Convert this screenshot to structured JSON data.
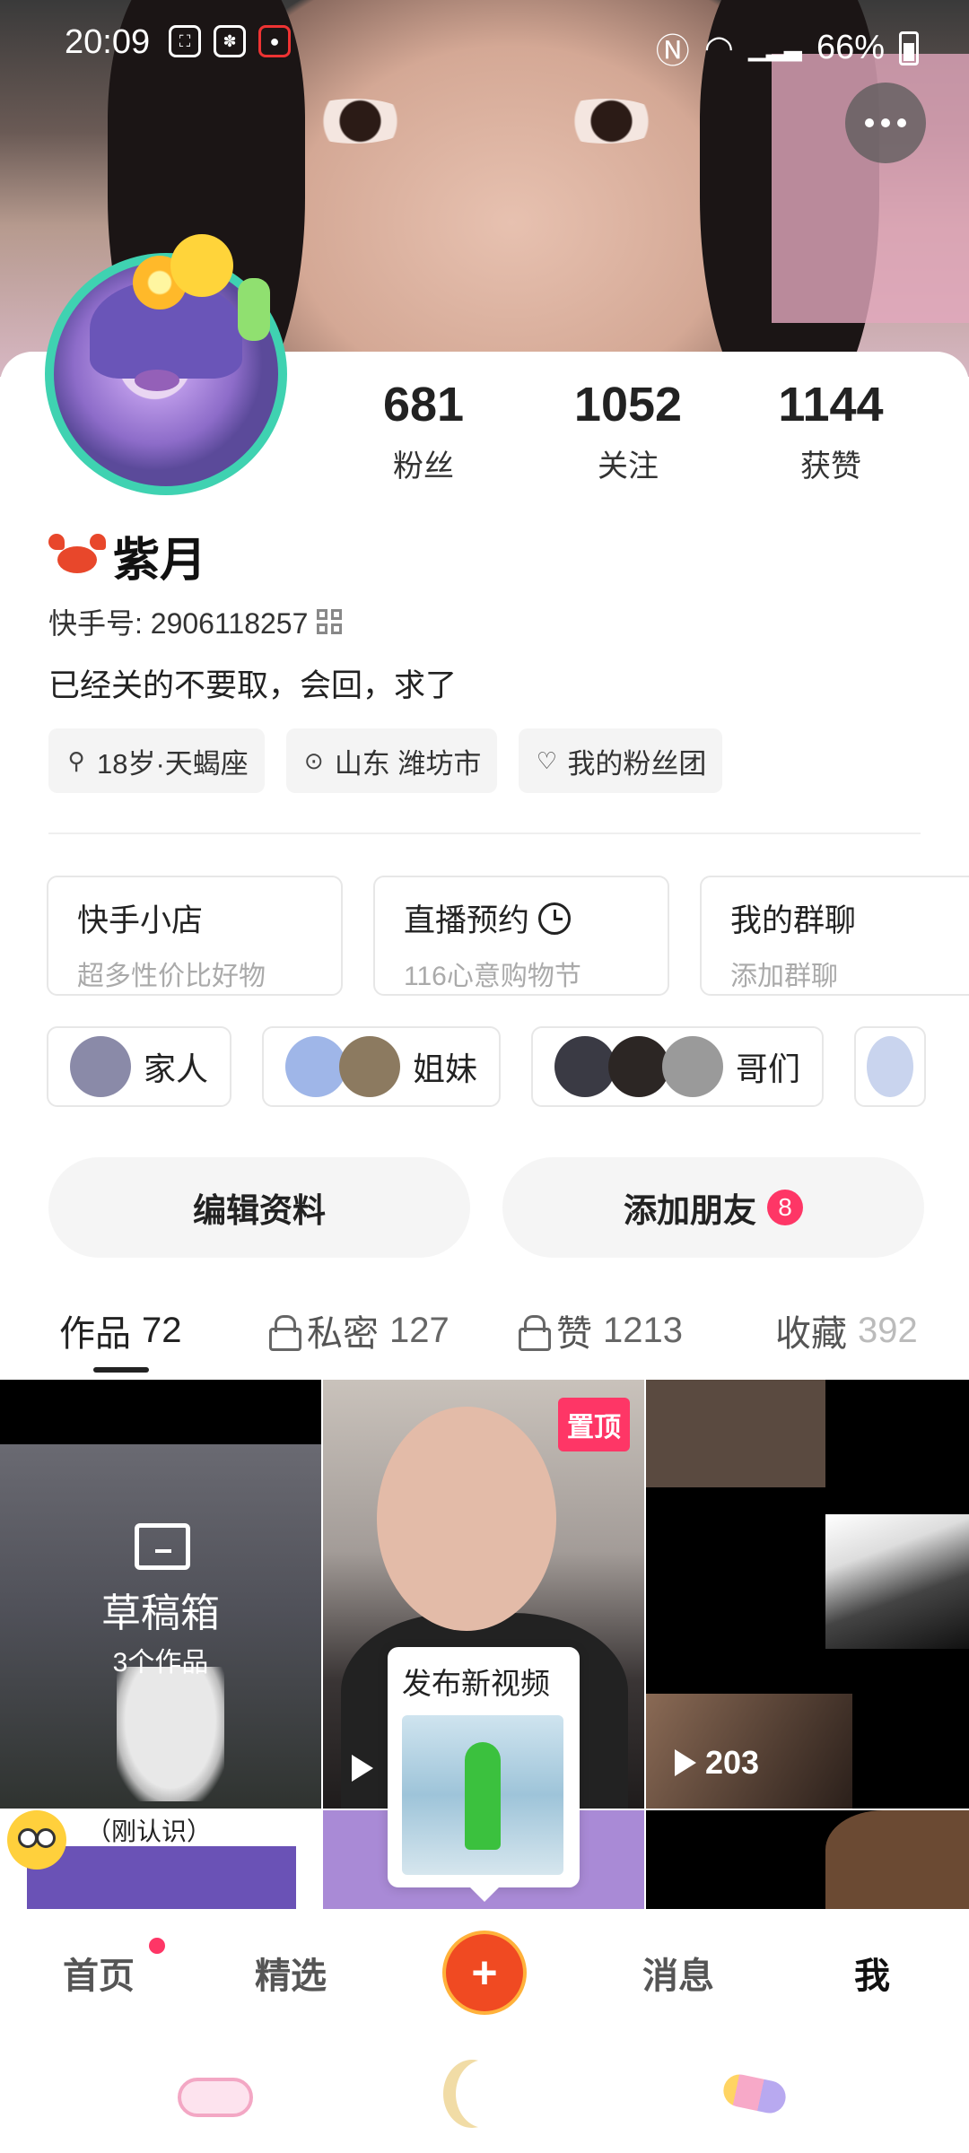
{
  "status_bar": {
    "time": "20:09",
    "battery": "66%",
    "icons": [
      "screenshot-icon",
      "baidu-icon",
      "record-icon",
      "nfc-icon",
      "wifi-icon",
      "signal-icon",
      "battery-icon"
    ]
  },
  "profile": {
    "stats": [
      {
        "value": "681",
        "label": "粉丝"
      },
      {
        "value": "1052",
        "label": "关注"
      },
      {
        "value": "1144",
        "label": "获赞"
      }
    ],
    "name": "紫月",
    "kuaishou_id": "快手号: 2906118257",
    "bio": "已经关的不要取，会回，求了",
    "tags": [
      {
        "icon": "gender-icon",
        "text": "18岁·天蝎座"
      },
      {
        "icon": "location-pin-icon",
        "text": "山东 潍坊市"
      },
      {
        "icon": "fan-club-icon",
        "text": "我的粉丝团"
      }
    ]
  },
  "entries": [
    {
      "title": "快手小店",
      "subtitle": "超多性价比好物"
    },
    {
      "title": "直播预约",
      "subtitle": "116心意购物节"
    },
    {
      "title": "我的群聊",
      "subtitle": "添加群聊"
    }
  ],
  "groups": [
    {
      "label": "家人",
      "avatars": [
        "#8a8aa8"
      ]
    },
    {
      "label": "姐妹",
      "avatars": [
        "#9fb6e8",
        "#8c7a60"
      ]
    },
    {
      "label": "哥们",
      "avatars": [
        "#3a3a44",
        "#2c2624",
        "#9a9a9a"
      ]
    },
    {
      "label": "",
      "avatars": [
        "#c9d4ee"
      ]
    }
  ],
  "buttons": {
    "edit_profile": "编辑资料",
    "add_friend": "添加朋友",
    "add_friend_badge": "8"
  },
  "tabs": [
    {
      "label": "作品",
      "count": "72",
      "locked": false
    },
    {
      "label": "私密",
      "count": "127",
      "locked": true
    },
    {
      "label": "赞",
      "count": "1213",
      "locked": true
    },
    {
      "label": "收藏",
      "count": "392",
      "locked": false
    }
  ],
  "grid": {
    "drafts_title": "草稿箱",
    "drafts_count": "3个作品",
    "pinned_label": "置顶",
    "item3_plays": "203",
    "item4_caption": "（刚认识）"
  },
  "publish_tip": {
    "title": "发布新视频"
  },
  "bottom_nav": {
    "home": "首页",
    "featured": "精选",
    "create": "+",
    "messages": "消息",
    "me": "我"
  },
  "colors": {
    "accent": "#fe3666",
    "create_button": "#f04a22",
    "avatar_ring": "#3fd2b1"
  }
}
